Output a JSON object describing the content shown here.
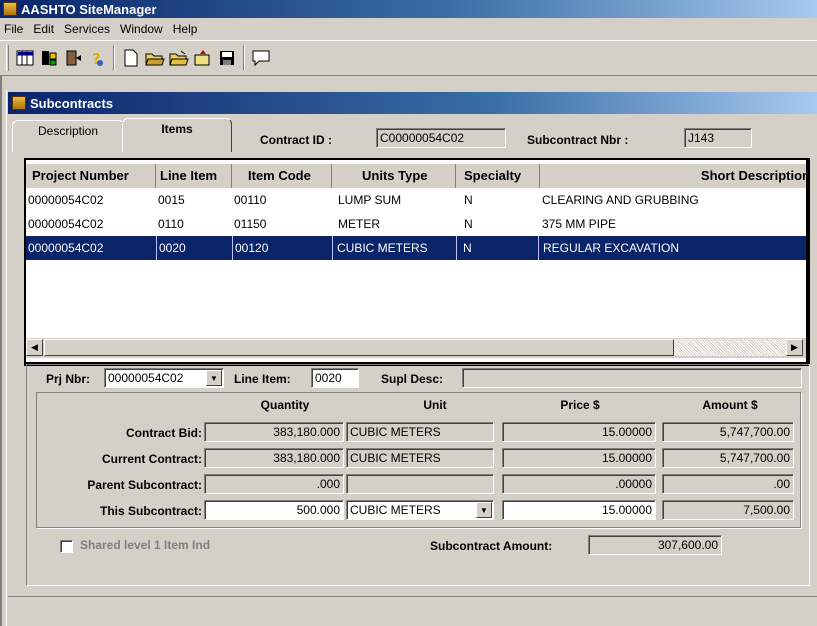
{
  "app": {
    "title": "AASHTO SiteManager"
  },
  "menu": [
    "File",
    "Edit",
    "Services",
    "Window",
    "Help"
  ],
  "toolbar": {
    "icons": [
      "grid-icon",
      "tools-icon",
      "door-icon",
      "help-icon",
      "new-icon",
      "open-icon",
      "open-folder-icon",
      "wizard-icon",
      "save-icon",
      "comment-icon"
    ]
  },
  "window": {
    "title": "Subcontracts"
  },
  "tabs": [
    {
      "label": "Description"
    },
    {
      "label": "Items"
    }
  ],
  "header": {
    "contract_id_label": "Contract ID :",
    "contract_id": "C00000054C02",
    "subcontract_nbr_label": "Subcontract Nbr :",
    "subcontract_nbr": "J143"
  },
  "grid": {
    "columns": [
      "Project Number",
      "Line Item",
      "Item Code",
      "Units Type",
      "Specialty",
      "Short Description"
    ],
    "rows": [
      [
        "00000054C02",
        "0015",
        "00110",
        "LUMP SUM",
        "N",
        "CLEARING AND GRUBBING"
      ],
      [
        "00000054C02",
        "0110",
        "01150",
        "METER",
        "N",
        "375 MM PIPE"
      ],
      [
        "00000054C02",
        "0020",
        "00120",
        "CUBIC METERS",
        "N",
        "REGULAR EXCAVATION"
      ]
    ],
    "selected_row": 2
  },
  "detail": {
    "prj_nbr_label": "Prj Nbr:",
    "prj_nbr": "00000054C02",
    "line_item_label": "Line Item:",
    "line_item": "0020",
    "supl_desc_label": "Supl Desc:",
    "supl_desc": ""
  },
  "amounts": {
    "headers": {
      "quantity": "Quantity",
      "unit": "Unit",
      "price": "Price $",
      "amount": "Amount $"
    },
    "rows": [
      {
        "label": "Contract Bid:",
        "quantity": "383,180.000",
        "unit": "CUBIC METERS",
        "price": "15.00000",
        "amount": "5,747,700.00"
      },
      {
        "label": "Current Contract:",
        "quantity": "383,180.000",
        "unit": "CUBIC METERS",
        "price": "15.00000",
        "amount": "5,747,700.00"
      },
      {
        "label": "Parent Subcontract:",
        "quantity": ".000",
        "unit": "",
        "price": ".00000",
        "amount": ".00"
      },
      {
        "label": "This Subcontract:",
        "quantity": "500.000",
        "unit": "CUBIC METERS",
        "price": "15.00000",
        "amount": "7,500.00"
      }
    ]
  },
  "footer": {
    "shared_label": "Shared level 1 Item Ind",
    "subcontract_amount_label": "Subcontract Amount:",
    "subcontract_amount": "307,600.00"
  }
}
